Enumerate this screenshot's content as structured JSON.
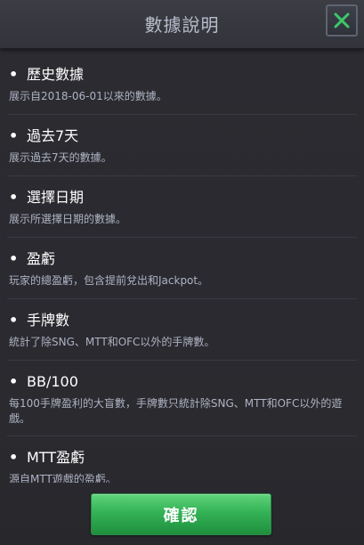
{
  "header": {
    "title": "數據說明",
    "close_icon": "close-icon",
    "accent_color": "#3cc86a"
  },
  "items": [
    {
      "bullet": "•",
      "title": "歷史數據",
      "desc": "展示自2018-06-01以來的數據。"
    },
    {
      "bullet": "•",
      "title": "過去7天",
      "desc": "展示過去7天的數據。"
    },
    {
      "bullet": "•",
      "title": "選擇日期",
      "desc": "展示所選擇日期的數據。"
    },
    {
      "bullet": "•",
      "title": "盈虧",
      "desc": "玩家的總盈虧，包含提前兌出和Jackpot。"
    },
    {
      "bullet": "•",
      "title": "手牌數",
      "desc": "統計了除SNG、MTT和OFC以外的手牌數。"
    },
    {
      "bullet": "•",
      "title": "BB/100",
      "desc": "每100手牌盈利的大盲數，手牌數只統計除SNG、MTT和OFC以外的遊戲。"
    },
    {
      "bullet": "•",
      "title": "MTT盈虧",
      "desc": "源自MTT遊戲的盈虧。"
    }
  ],
  "footer": {
    "confirm_label": "確認",
    "button_color": "#34b256"
  }
}
